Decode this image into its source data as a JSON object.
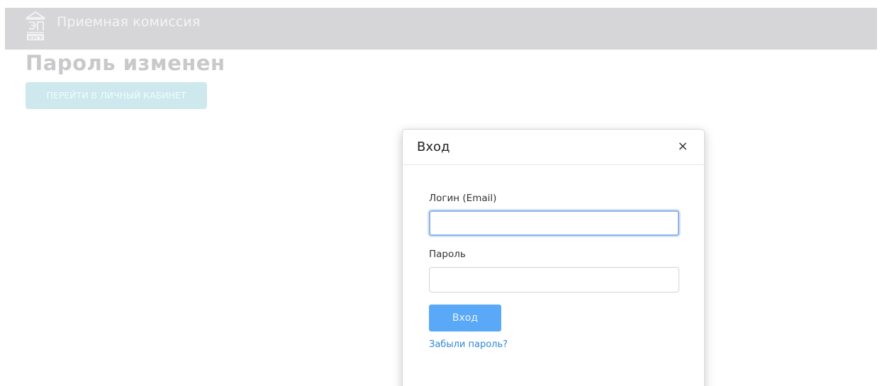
{
  "header": {
    "title": "Приемная комиссия",
    "logo_text": "ВЭГУ"
  },
  "main": {
    "heading": "Пароль изменен",
    "cabinet_button": "ПЕРЕЙТИ В ЛИЧНЫЙ КАБИНЕТ"
  },
  "login_modal": {
    "title": "Вход",
    "close_symbol": "×",
    "login_label": "Логин (Email)",
    "login_value": "",
    "password_label": "Пароль",
    "password_value": "",
    "submit_label": "Вход",
    "forgot_link": "Забыли пароль?"
  },
  "colors": {
    "header_bg": "#d6d6d8",
    "primary_button": "#5aa8f8",
    "link": "#2f86d6",
    "focus_ring": "#8eb3e8"
  }
}
